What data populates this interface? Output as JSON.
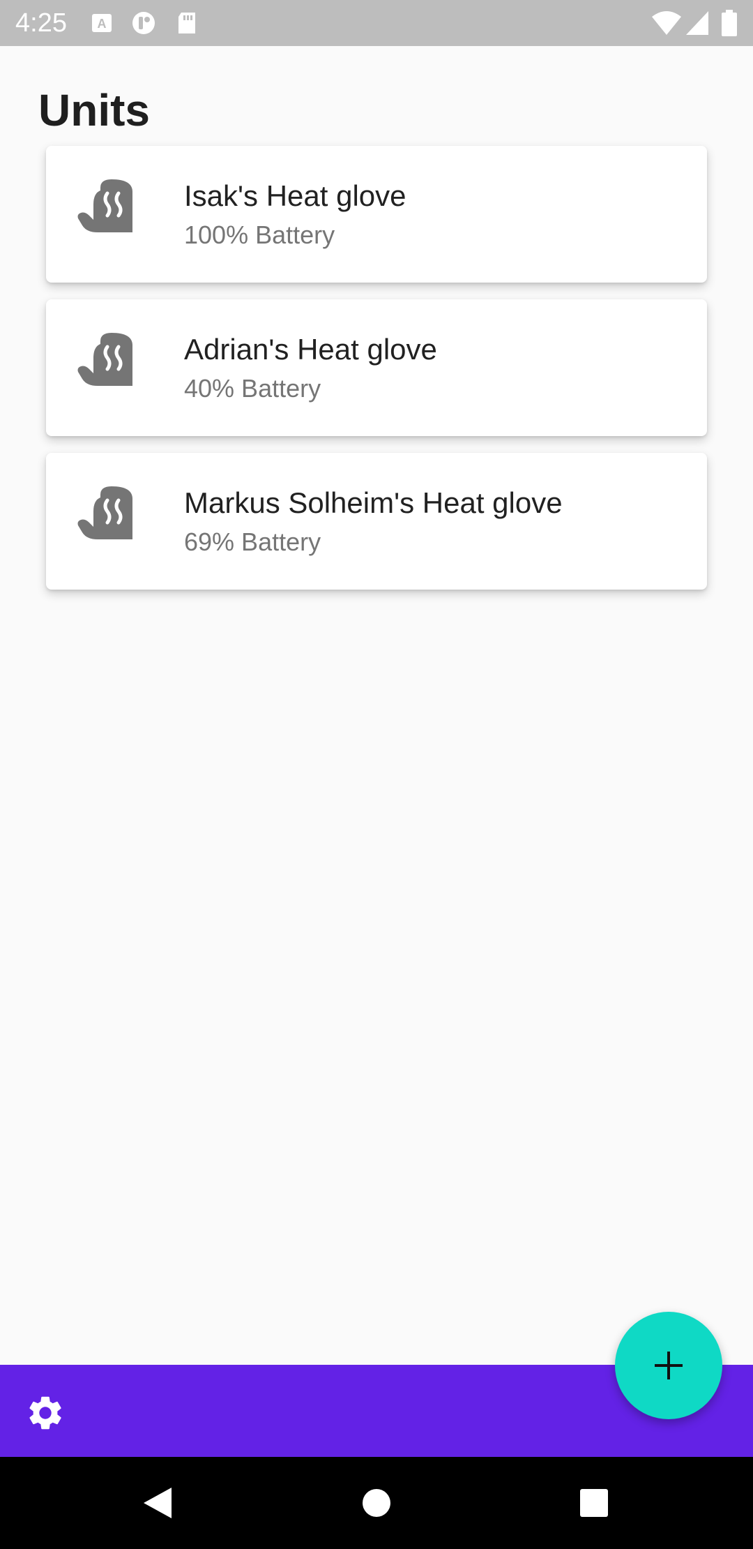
{
  "status_bar": {
    "time": "4:25",
    "icons": [
      "keyboard-icon",
      "sim-icon",
      "sd-card-icon",
      "wifi-icon",
      "signal-icon",
      "battery-icon"
    ]
  },
  "header": {
    "title": "Units"
  },
  "units": [
    {
      "name": "Isak's Heat glove",
      "battery": "100% Battery",
      "icon": "heat-glove-icon"
    },
    {
      "name": "Adrian's Heat glove",
      "battery": "40% Battery",
      "icon": "heat-glove-icon"
    },
    {
      "name": "Markus Solheim's Heat glove",
      "battery": "69% Battery",
      "icon": "heat-glove-icon"
    }
  ],
  "bottom_bar": {
    "settings_icon": "gear-icon",
    "color": "#6322e6"
  },
  "fab": {
    "icon": "plus-icon",
    "color": "#0fd9c5"
  },
  "nav_bar": {
    "icons": [
      "back-icon",
      "home-icon",
      "recents-icon"
    ]
  }
}
